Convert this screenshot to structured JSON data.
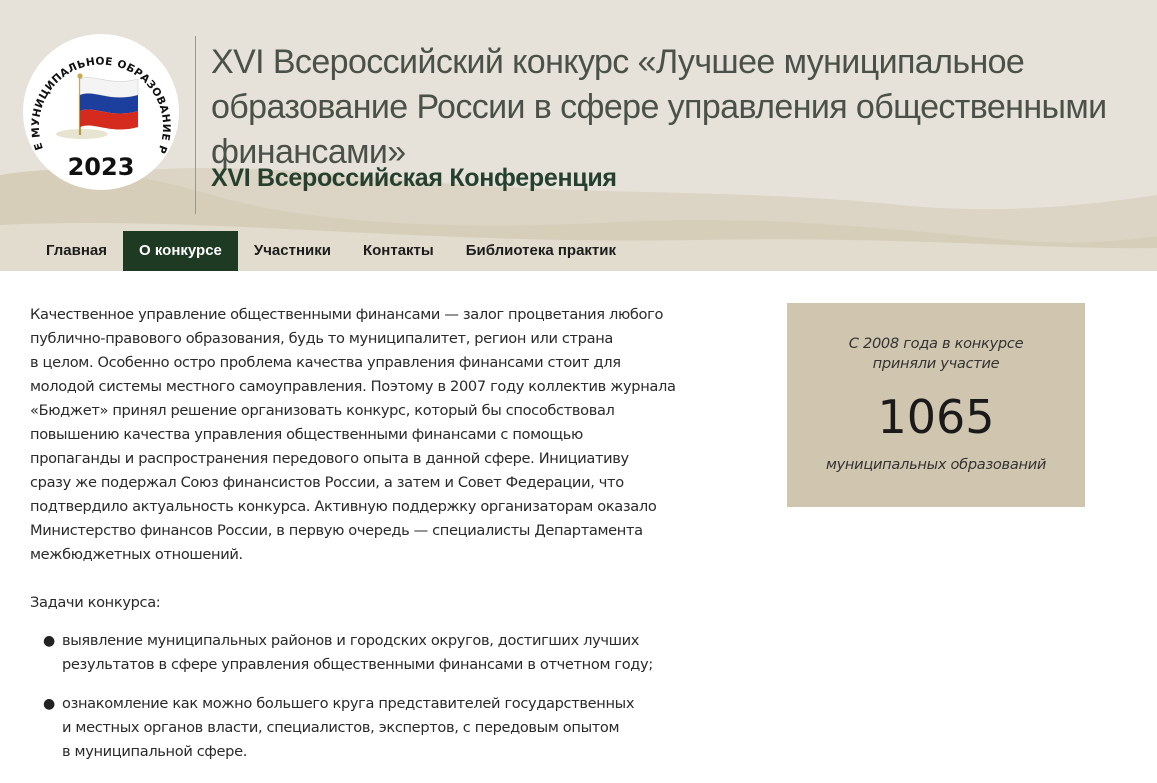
{
  "header": {
    "logo": {
      "arc_text": "ЛУЧШЕЕ МУНИЦИПАЛЬНОЕ ОБРАЗОВАНИЕ РОССИИ",
      "year": "2023",
      "flag_colors": [
        "#ffffff",
        "#1c3f9e",
        "#d52b1e"
      ]
    },
    "title": "XVI Всероссийский конкурс «Лучшее муниципальное образование России в сфере управления общественными финансами»",
    "subtitle": "XVI Всероссийская Конференция"
  },
  "nav": {
    "items": [
      {
        "label": "Главная"
      },
      {
        "label": "О конкурсе",
        "active": true
      },
      {
        "label": "Участники"
      },
      {
        "label": "Контакты"
      },
      {
        "label": "Библиотека практик"
      }
    ]
  },
  "main": {
    "paragraph": "Качественное управление общественными финансами — залог процветания любого\nпублично-правового образования, будь то муниципалитет, регион или страна\nв целом. Особенно остро проблема качества управления финансами стоит для\nмолодой системы местного самоуправления. Поэтому в 2007 году коллектив журнала\n«Бюджет» принял решение организовать конкурс, который бы способствовал\nповышению качества управления общественными финансами с помощью\nпропаганды и распространения передового опыта в данной сфере. Инициативу\nсразу же подержал Союз финансистов России, а затем и Совет Федерации, что\nподтвердило актуальность конкурса. Активную поддержку организаторам оказало\nМинистерство финансов России, в первую очередь — специалисты Департамента\nмежбюджетных отношений.",
    "tasks_label": "Задачи конкурса:",
    "tasks": [
      "выявление муниципальных районов и городских округов, достигших лучших\nрезультатов в сфере управления общественными финансами в отчетном году;",
      "ознакомление как можно большего круга представителей государственных\nи местных органов власти, специалистов, экспертов, с передовым опытом\nв муниципальной сфере."
    ]
  },
  "stat": {
    "caption": "С 2008 года в конкурсе\nприняли участие",
    "number": "1065",
    "unit": "муниципальных образований"
  },
  "colors": {
    "header_bg": "#e6e2da",
    "accent_green": "#1e3a23",
    "stat_bg": "#d0c6b0"
  }
}
